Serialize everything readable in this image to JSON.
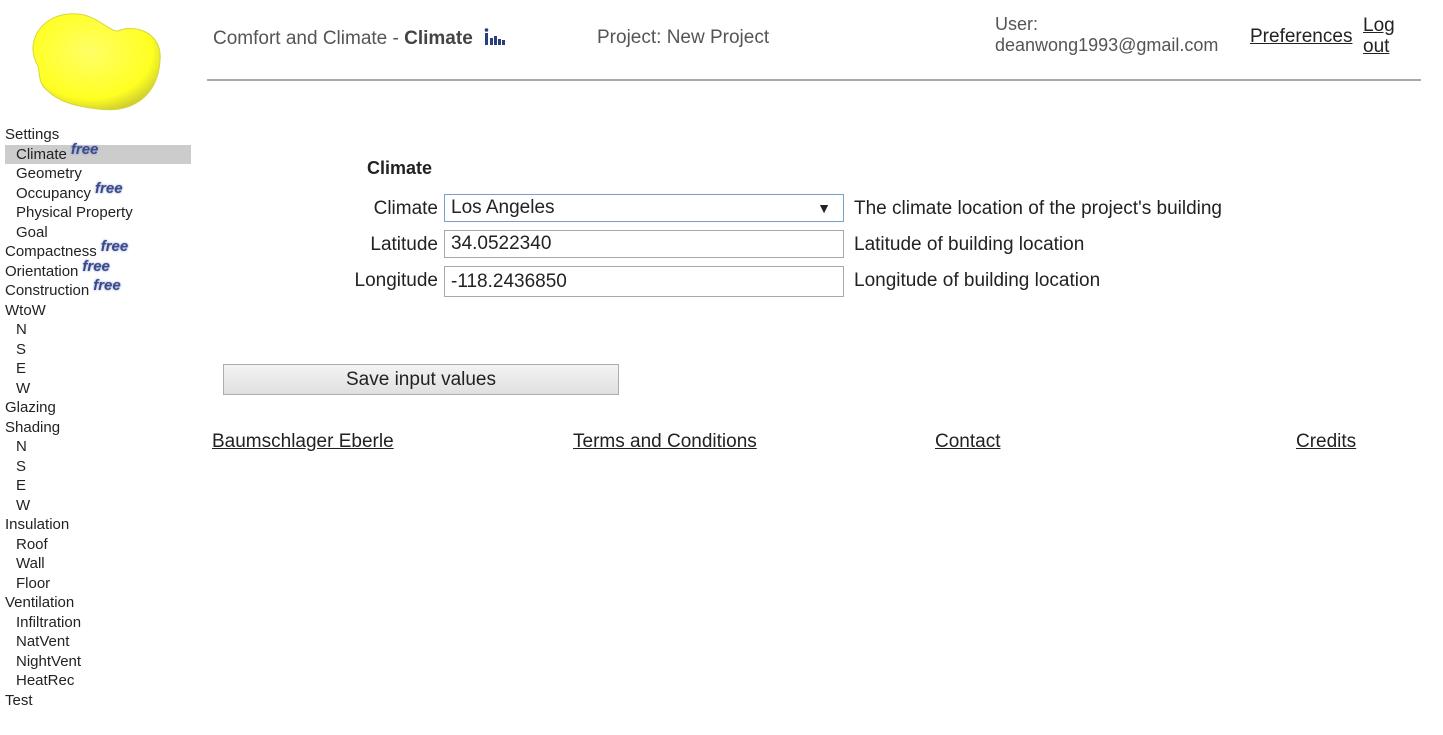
{
  "header": {
    "app_title": "Comfort and Climate - ",
    "app_title_bold": "Climate",
    "project": "Project: New Project",
    "user_label": "User:",
    "user_email": "deanwong1993@gmail.com",
    "preferences_link": "Preferences",
    "logout_line1": "Log",
    "logout_line2": "out"
  },
  "colors": {
    "logo_yellow": "#ffff33",
    "active_item_bg": "#cccccc",
    "badge_blue": "#3b4a8a"
  },
  "sidebar": {
    "badge": "free",
    "items": [
      {
        "label": "Settings"
      },
      {
        "label": "Climate"
      },
      {
        "label": "Geometry"
      },
      {
        "label": "Occupancy"
      },
      {
        "label": "Physical Property"
      },
      {
        "label": "Goal"
      },
      {
        "label": "Compactness"
      },
      {
        "label": "Orientation"
      },
      {
        "label": "Construction"
      },
      {
        "label": "WtoW"
      },
      {
        "label": "N"
      },
      {
        "label": "S"
      },
      {
        "label": "E"
      },
      {
        "label": "W"
      },
      {
        "label": "Glazing"
      },
      {
        "label": "Shading"
      },
      {
        "label": "N"
      },
      {
        "label": "S"
      },
      {
        "label": "E"
      },
      {
        "label": "W"
      },
      {
        "label": "Insulation"
      },
      {
        "label": "Roof"
      },
      {
        "label": "Wall"
      },
      {
        "label": "Floor"
      },
      {
        "label": "Ventilation"
      },
      {
        "label": "Infiltration"
      },
      {
        "label": "NatVent"
      },
      {
        "label": "NightVent"
      },
      {
        "label": "HeatRec"
      },
      {
        "label": "Test"
      }
    ]
  },
  "form": {
    "section_title": "Climate",
    "climate": {
      "label": "Climate",
      "value": "Los Angeles",
      "description": "The climate location of the project's building"
    },
    "latitude": {
      "label": "Latitude",
      "value": "34.0522340",
      "description": "Latitude of building location"
    },
    "longitude": {
      "label": "Longitude",
      "value": "-118.2436850",
      "description": "Longitude of building location"
    },
    "save_button": "Save input values"
  },
  "footer": {
    "link1": "Baumschlager Eberle",
    "link2": "Terms and Conditions",
    "link3": "Contact",
    "link4": "Credits"
  }
}
